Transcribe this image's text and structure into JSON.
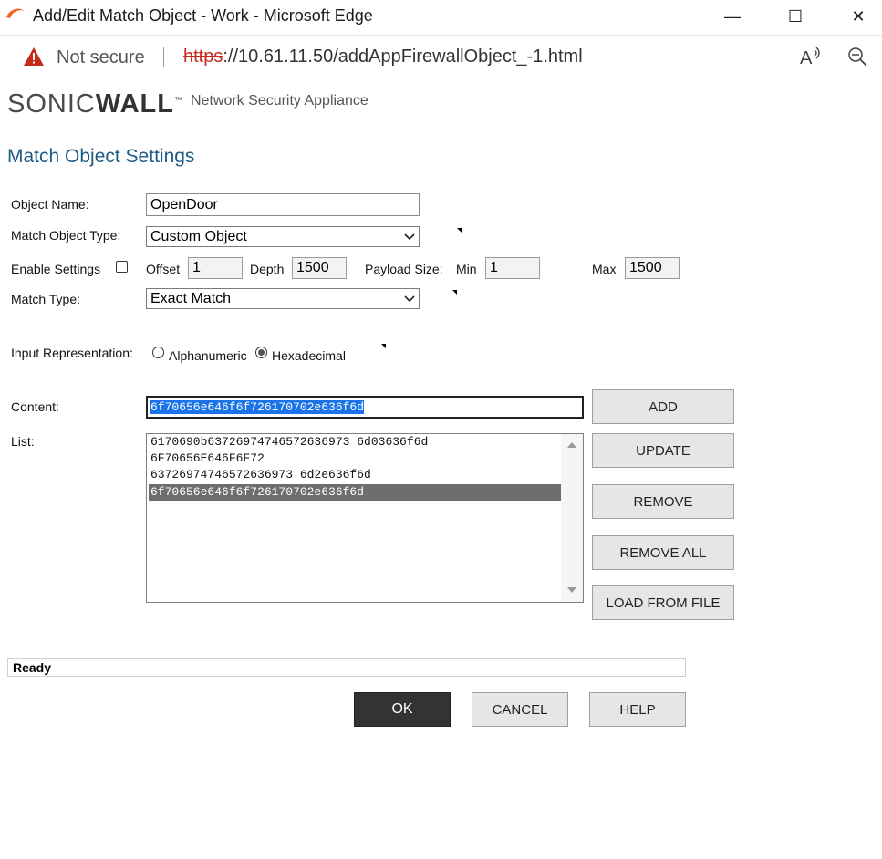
{
  "window": {
    "title": "Add/Edit Match Object - Work - Microsoft Edge",
    "minimize_glyph": "—",
    "maximize_glyph": "☐",
    "close_glyph": "✕"
  },
  "addressbar": {
    "security_label": "Not secure",
    "url_scheme": "https",
    "url_rest": "://10.61.11.50/addAppFirewallObject_-1.html"
  },
  "brand": {
    "logo_part1": "SONIC",
    "logo_part2": "WALL",
    "logo_tm": "™",
    "subtitle": "Network Security Appliance"
  },
  "page": {
    "heading": "Match Object Settings"
  },
  "form": {
    "object_name_label": "Object Name:",
    "object_name_value": "OpenDoor",
    "match_object_type_label": "Match Object Type:",
    "match_object_type_value": "Custom Object",
    "enable_settings_label": "Enable Settings",
    "offset_label": "Offset",
    "offset_value": "1",
    "depth_label": "Depth",
    "depth_value": "1500",
    "payload_size_label": "Payload Size:",
    "min_label": "Min",
    "min_value": "1",
    "max_label": "Max",
    "max_value": "1500",
    "match_type_label": "Match Type:",
    "match_type_value": "Exact Match",
    "input_rep_label": "Input Representation:",
    "alphanumeric_label": "Alphanumeric",
    "hexadecimal_label": "Hexadecimal",
    "content_label": "Content:",
    "content_value": "6f70656e646f6f726170702e636f6d",
    "list_label": "List:",
    "list_items": [
      "6170690b63726974746572636973 6d03636f6d",
      "6F70656E646F6F72",
      "63726974746572636973 6d2e636f6d",
      "6f70656e646f6f726170702e636f6d"
    ]
  },
  "buttons": {
    "add": "ADD",
    "update": "UPDATE",
    "remove": "REMOVE",
    "remove_all": "REMOVE ALL",
    "load_from_file": "LOAD FROM FILE",
    "ok": "OK",
    "cancel": "CANCEL",
    "help": "HELP"
  },
  "status": {
    "text": "Ready"
  },
  "colors": {
    "heading": "#1d5a86",
    "selected_row": "#6e6e6e",
    "ok_button": "#333333",
    "warning": "#c42b1c"
  }
}
